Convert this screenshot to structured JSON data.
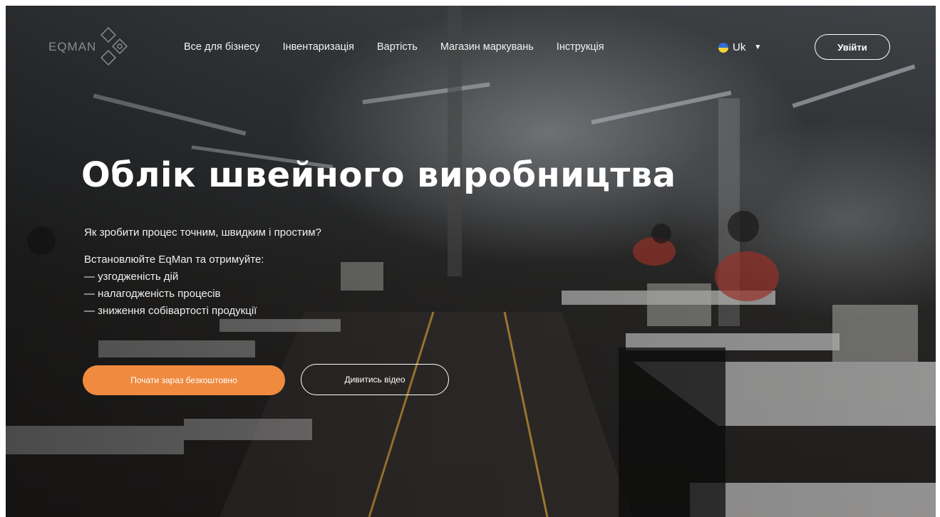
{
  "header": {
    "logo_text": "EQMAN",
    "nav": [
      "Все для бізнесу",
      "Інвентаризація",
      "Вартість",
      "Магазин маркувань",
      "Інструкція"
    ],
    "language": "Uk",
    "login_label": "Увійти"
  },
  "hero": {
    "title": "Облік швейного виробництва",
    "question": "Як зробити процес точним, швидким і простим?",
    "intro": "Встановлюйте EqMan та отримуйте:",
    "benefits": [
      "— узгодженість дій",
      "— налагодженість процесів",
      "— зниження собівартості продукції"
    ],
    "primary_button": "Почати зараз безкоштовно",
    "secondary_button": "Дивитись відео"
  },
  "colors": {
    "accent": "#ef8a3f"
  }
}
